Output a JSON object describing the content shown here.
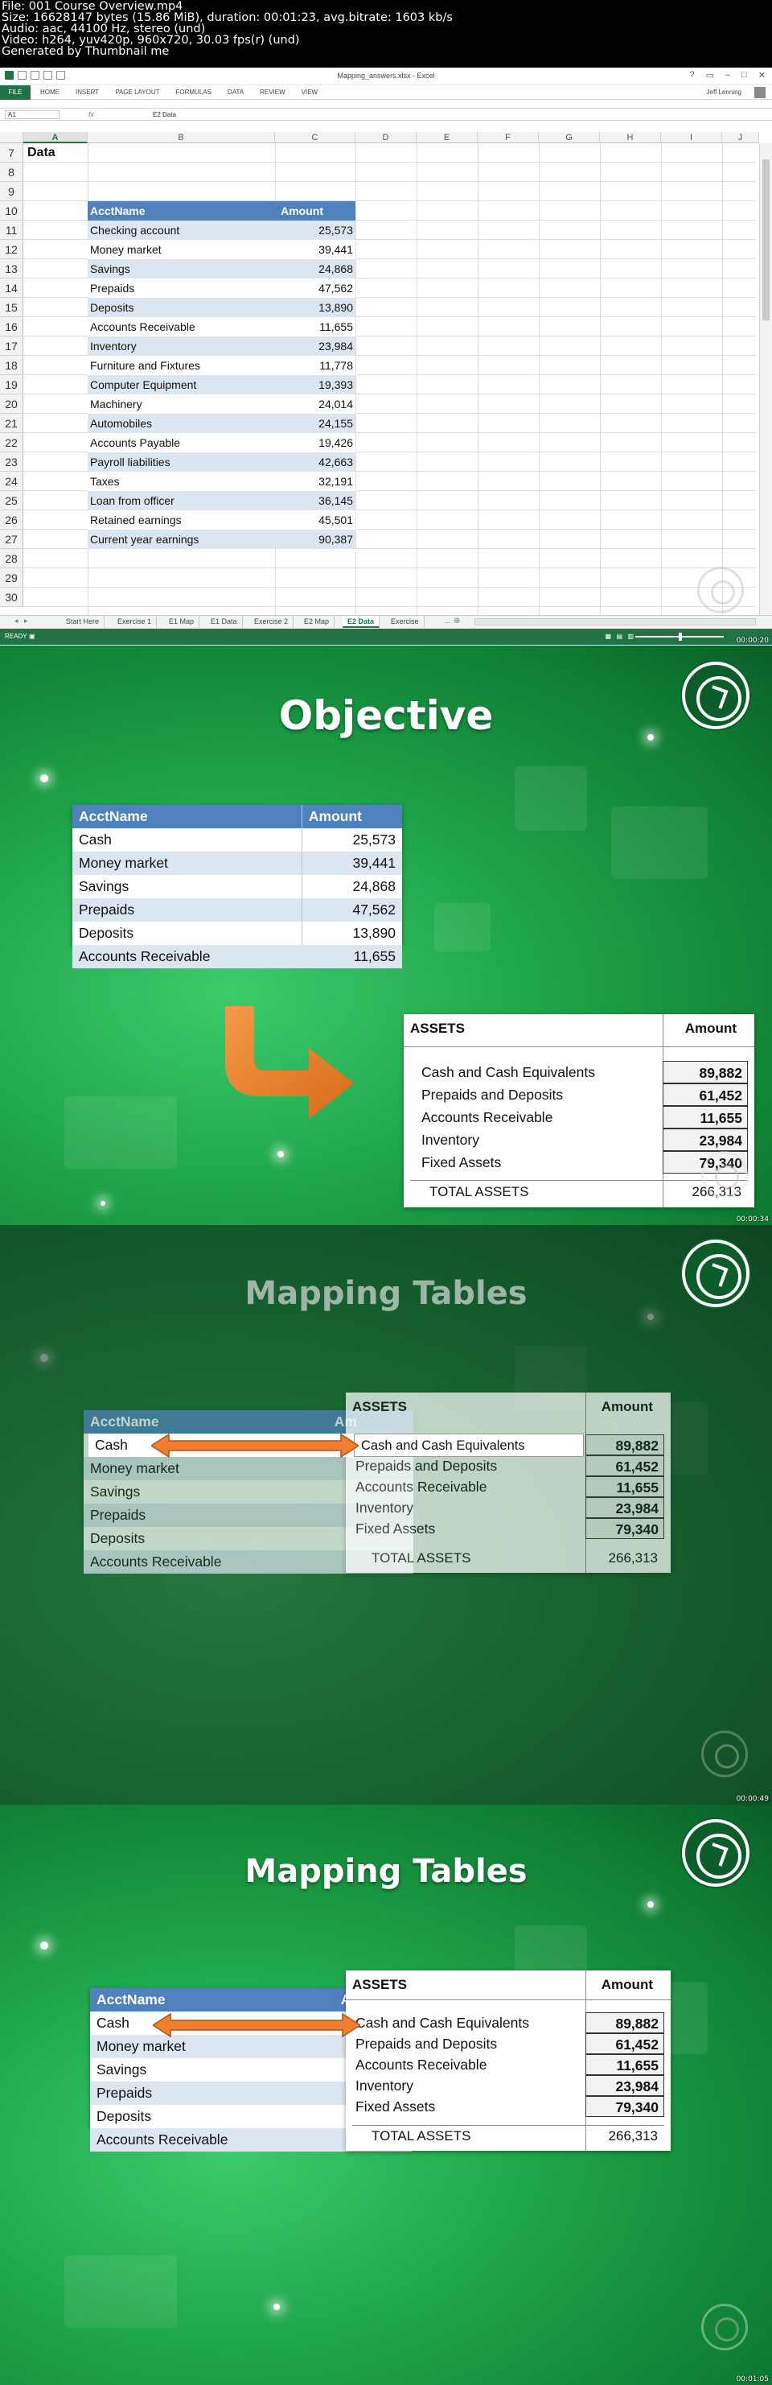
{
  "info": {
    "lines": [
      "File: 001 Course Overview.mp4",
      "Size: 16628147 bytes (15.86 MiB), duration: 00:01:23, avg.bitrate: 1603 kb/s",
      "Audio: aac, 44100 Hz, stereo (und)",
      "Video: h264, yuv420p, 960x720, 30.03 fps(r) (und)",
      "Generated by Thumbnail me"
    ]
  },
  "excel": {
    "window_title": "Mapping_answers.xlsx - Excel",
    "ribbon_tabs": [
      "FILE",
      "HOME",
      "INSERT",
      "PAGE LAYOUT",
      "FORMULAS",
      "DATA",
      "REVIEW",
      "VIEW"
    ],
    "user": "Jeff Lenning",
    "name_box": "A1",
    "formula": "E2 Data",
    "columns": [
      "A",
      "B",
      "C",
      "D",
      "E",
      "F",
      "G",
      "H",
      "I",
      "J"
    ],
    "rows": [
      "7",
      "8",
      "9",
      "10",
      "11",
      "12",
      "13",
      "14",
      "15",
      "16",
      "17",
      "18",
      "19",
      "20",
      "21",
      "22",
      "23",
      "24",
      "25",
      "26",
      "27",
      "28",
      "29",
      "30"
    ],
    "cell_a7": "Data",
    "table_header": {
      "name": "AcctName",
      "amount": "Amount"
    },
    "table_rows": [
      {
        "name": "Checking account",
        "amount": "25,573"
      },
      {
        "name": "Money market",
        "amount": "39,441"
      },
      {
        "name": "Savings",
        "amount": "24,868"
      },
      {
        "name": "Prepaids",
        "amount": "47,562"
      },
      {
        "name": "Deposits",
        "amount": "13,890"
      },
      {
        "name": "Accounts Receivable",
        "amount": "11,655"
      },
      {
        "name": "Inventory",
        "amount": "23,984"
      },
      {
        "name": "Furniture and Fixtures",
        "amount": "11,778"
      },
      {
        "name": "Computer Equipment",
        "amount": "19,393"
      },
      {
        "name": "Machinery",
        "amount": "24,014"
      },
      {
        "name": "Automobiles",
        "amount": "24,155"
      },
      {
        "name": "Accounts Payable",
        "amount": "19,426"
      },
      {
        "name": "Payroll liabilities",
        "amount": "42,663"
      },
      {
        "name": "Taxes",
        "amount": "32,191"
      },
      {
        "name": "Loan from officer",
        "amount": "36,145"
      },
      {
        "name": "Retained earnings",
        "amount": "45,501"
      },
      {
        "name": "Current year earnings",
        "amount": "90,387"
      }
    ],
    "sheet_tabs": [
      "Start Here",
      "Exercise 1",
      "E1 Map",
      "E1 Data",
      "Exercise 2",
      "E2 Map",
      "E2 Data",
      "Exercise"
    ],
    "active_sheet": "E2 Data",
    "status": "READY",
    "zoom": "",
    "timestamp": "00:00:20"
  },
  "slide1": {
    "title": "Objective",
    "timestamp": "00:00:34",
    "table_header": {
      "name": "AcctName",
      "amount": "Amount"
    },
    "table_rows": [
      {
        "name": "Cash",
        "amount": "25,573"
      },
      {
        "name": "Money market",
        "amount": "39,441"
      },
      {
        "name": "Savings",
        "amount": "24,868"
      },
      {
        "name": "Prepaids",
        "amount": "47,562"
      },
      {
        "name": "Deposits",
        "amount": "13,890"
      },
      {
        "name": "Accounts Receivable",
        "amount": "11,655"
      }
    ],
    "assets_header": {
      "name": "ASSETS",
      "amount": "Amount"
    },
    "assets_rows": [
      {
        "name": "Cash and Cash Equivalents",
        "amount": "89,882"
      },
      {
        "name": "Prepaids and Deposits",
        "amount": "61,452"
      },
      {
        "name": "Accounts Receivable",
        "amount": "11,655"
      },
      {
        "name": "Inventory",
        "amount": "23,984"
      },
      {
        "name": "Fixed Assets",
        "amount": "79,340"
      }
    ],
    "total": {
      "name": "TOTAL ASSETS",
      "amount": "266,313"
    }
  },
  "slide2": {
    "title": "Mapping Tables",
    "timestamp": "00:00:49",
    "table_header": {
      "name": "AcctName",
      "amount": "Am"
    },
    "table_rows": [
      {
        "name": "Cash"
      },
      {
        "name": "Money market"
      },
      {
        "name": "Savings"
      },
      {
        "name": "Prepaids"
      },
      {
        "name": "Deposits"
      },
      {
        "name": "Accounts Receivable"
      }
    ],
    "assets_header": {
      "name": "ASSETS",
      "amount": "Amount"
    },
    "assets_rows": [
      {
        "name": "Cash and Cash Equivalents",
        "amount": "89,882"
      },
      {
        "name": "Prepaids and Deposits",
        "amount": "61,452"
      },
      {
        "name": "Accounts Receivable",
        "amount": "11,655"
      },
      {
        "name": "Inventory",
        "amount": "23,984"
      },
      {
        "name": "Fixed Assets",
        "amount": "79,340"
      }
    ],
    "total": {
      "name": "TOTAL ASSETS",
      "amount": "266,313"
    }
  },
  "slide3": {
    "title": "Mapping Tables",
    "timestamp": "00:01:05",
    "table_header": {
      "name": "AcctName",
      "amount": "Am"
    },
    "table_rows": [
      {
        "name": "Cash"
      },
      {
        "name": "Money market"
      },
      {
        "name": "Savings"
      },
      {
        "name": "Prepaids"
      },
      {
        "name": "Deposits"
      },
      {
        "name": "Accounts Receivable"
      }
    ],
    "assets_header": {
      "name": "ASSETS",
      "amount": "Amount"
    },
    "assets_rows": [
      {
        "name": "Cash and Cash Equivalents",
        "amount": "89,882"
      },
      {
        "name": "Prepaids and Deposits",
        "amount": "61,452"
      },
      {
        "name": "Accounts Receivable",
        "amount": "11,655"
      },
      {
        "name": "Inventory",
        "amount": "23,984"
      },
      {
        "name": "Fixed Assets",
        "amount": "79,340"
      }
    ],
    "total": {
      "name": "TOTAL ASSETS",
      "amount": "266,313"
    }
  },
  "colors": {
    "header_blue": "#4f81bd",
    "band_blue": "#dce6f1",
    "excel_green": "#217346",
    "arrow_orange": "#f08030"
  }
}
